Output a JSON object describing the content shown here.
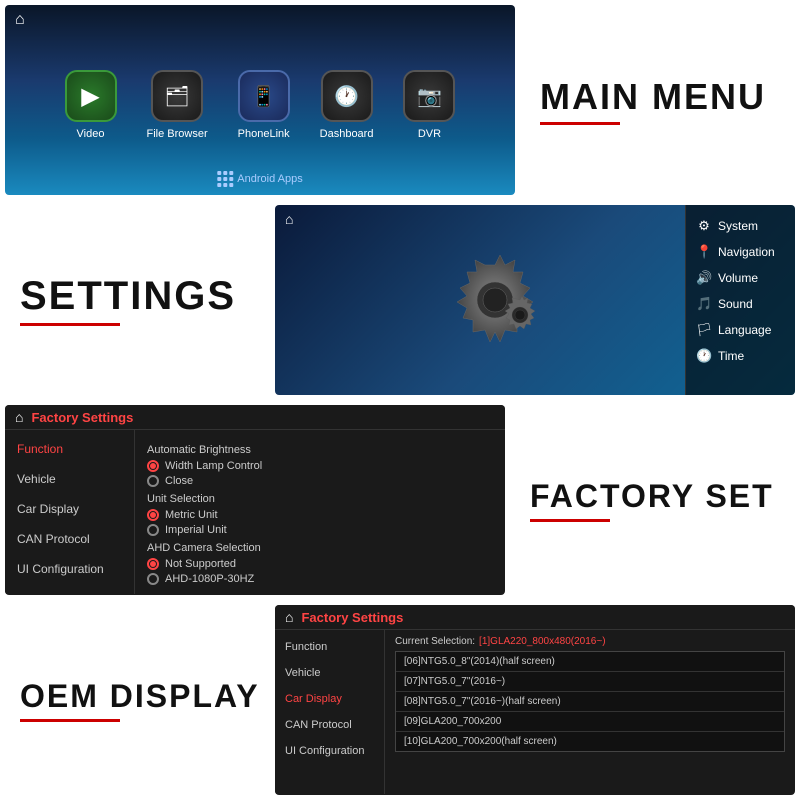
{
  "sections": {
    "main_menu": {
      "label": "MAIN MENU",
      "screen": {
        "home_icon": "⌂",
        "android_apps": "Android Apps",
        "items": [
          {
            "id": "video",
            "label": "Video",
            "icon": "▶"
          },
          {
            "id": "file-browser",
            "label": "File Browser",
            "icon": "📁"
          },
          {
            "id": "phonelink",
            "label": "PhoneLink",
            "icon": "📱"
          },
          {
            "id": "dashboard",
            "label": "Dashboard",
            "icon": "🕐"
          },
          {
            "id": "dvr",
            "label": "DVR",
            "icon": "📷"
          }
        ]
      }
    },
    "settings": {
      "label": "SETTINGS",
      "screen": {
        "home_icon": "⌂",
        "menu_items": [
          {
            "label": "System",
            "icon": "⚙"
          },
          {
            "label": "Navigation",
            "icon": "📍"
          },
          {
            "label": "Volume",
            "icon": "🔊"
          },
          {
            "label": "Sound",
            "icon": "🎵"
          },
          {
            "label": "Language",
            "icon": "🏳"
          },
          {
            "label": "Time",
            "icon": "🕐"
          }
        ]
      }
    },
    "factory_set": {
      "label": "FACTORY SET",
      "screen": {
        "home_icon": "⌂",
        "title": "Factory Settings",
        "sidebar_items": [
          {
            "label": "Function",
            "active": true
          },
          {
            "label": "Vehicle",
            "active": false
          },
          {
            "label": "Car Display",
            "active": false
          },
          {
            "label": "CAN Protocol",
            "active": false
          },
          {
            "label": "UI Configuration",
            "active": false
          }
        ],
        "content": {
          "sections": [
            {
              "title": "Automatic Brightness",
              "options": [
                {
                  "label": "Width Lamp Control",
                  "selected": true
                },
                {
                  "label": "Close",
                  "selected": false
                }
              ]
            },
            {
              "title": "Unit Selection",
              "options": [
                {
                  "label": "Metric Unit",
                  "selected": true
                },
                {
                  "label": "Imperial Unit",
                  "selected": false
                }
              ]
            },
            {
              "title": "AHD Camera Selection",
              "options": [
                {
                  "label": "Not Supported",
                  "selected": true
                },
                {
                  "label": "AHD-1080P-30HZ",
                  "selected": false
                }
              ]
            }
          ]
        }
      }
    },
    "oem_display": {
      "label": "OEM DISPLAY",
      "screen": {
        "home_icon": "⌂",
        "title": "Factory Settings",
        "sidebar_items": [
          {
            "label": "Function",
            "active": false
          },
          {
            "label": "Vehicle",
            "active": false
          },
          {
            "label": "Car Display",
            "active": true
          },
          {
            "label": "CAN Protocol",
            "active": false
          },
          {
            "label": "UI Configuration",
            "active": false
          }
        ],
        "content": {
          "current_label": "Current Selection:",
          "current_value": "[1]GLA220_800x480(2016~)",
          "list_items": [
            "[06]NTG5.0_8\"(2014)(half screen)",
            "[07]NTG5.0_7\"(2016~)",
            "[08]NTG5.0_7\"(2016~)(half screen)",
            "[09]GLA200_700x200",
            "[10]GLA200_700x200(half screen)"
          ]
        }
      }
    }
  }
}
